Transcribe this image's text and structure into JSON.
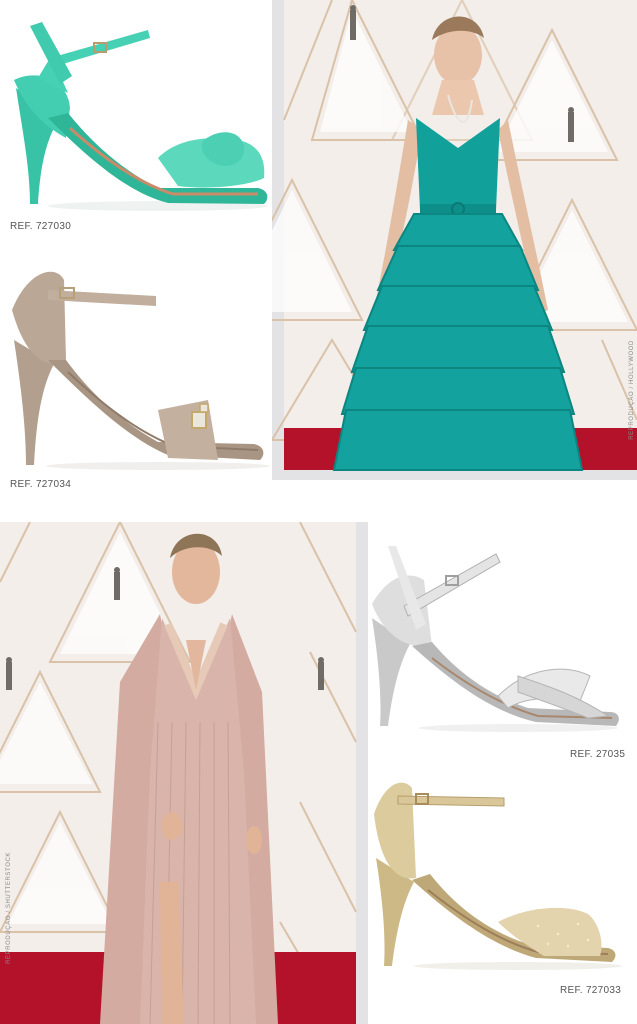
{
  "products": [
    {
      "ref": "REF. 727030",
      "color_name": "turquoise",
      "color": "#3fc9ae"
    },
    {
      "ref": "REF. 727034",
      "color_name": "nude",
      "color": "#b9a594"
    },
    {
      "ref": "REF. 27035",
      "color_name": "silver",
      "color": "#d8d8d8"
    },
    {
      "ref": "REF. 727033",
      "color_name": "gold",
      "color": "#d8c590"
    }
  ],
  "photos": [
    {
      "credit": "REPRODUÇÃO / HOLLYWOOD",
      "dress_color": "#12a09b"
    },
    {
      "credit": "REPRODUÇÃO / SHUTTERSTOCK",
      "dress_color": "#d7b1a8"
    }
  ],
  "colors": {
    "carpet": "#b4122a",
    "backdrop": "#f3eeea",
    "backdrop_line": "#d9c2a8",
    "photo_frame": "#e3e3e6"
  }
}
